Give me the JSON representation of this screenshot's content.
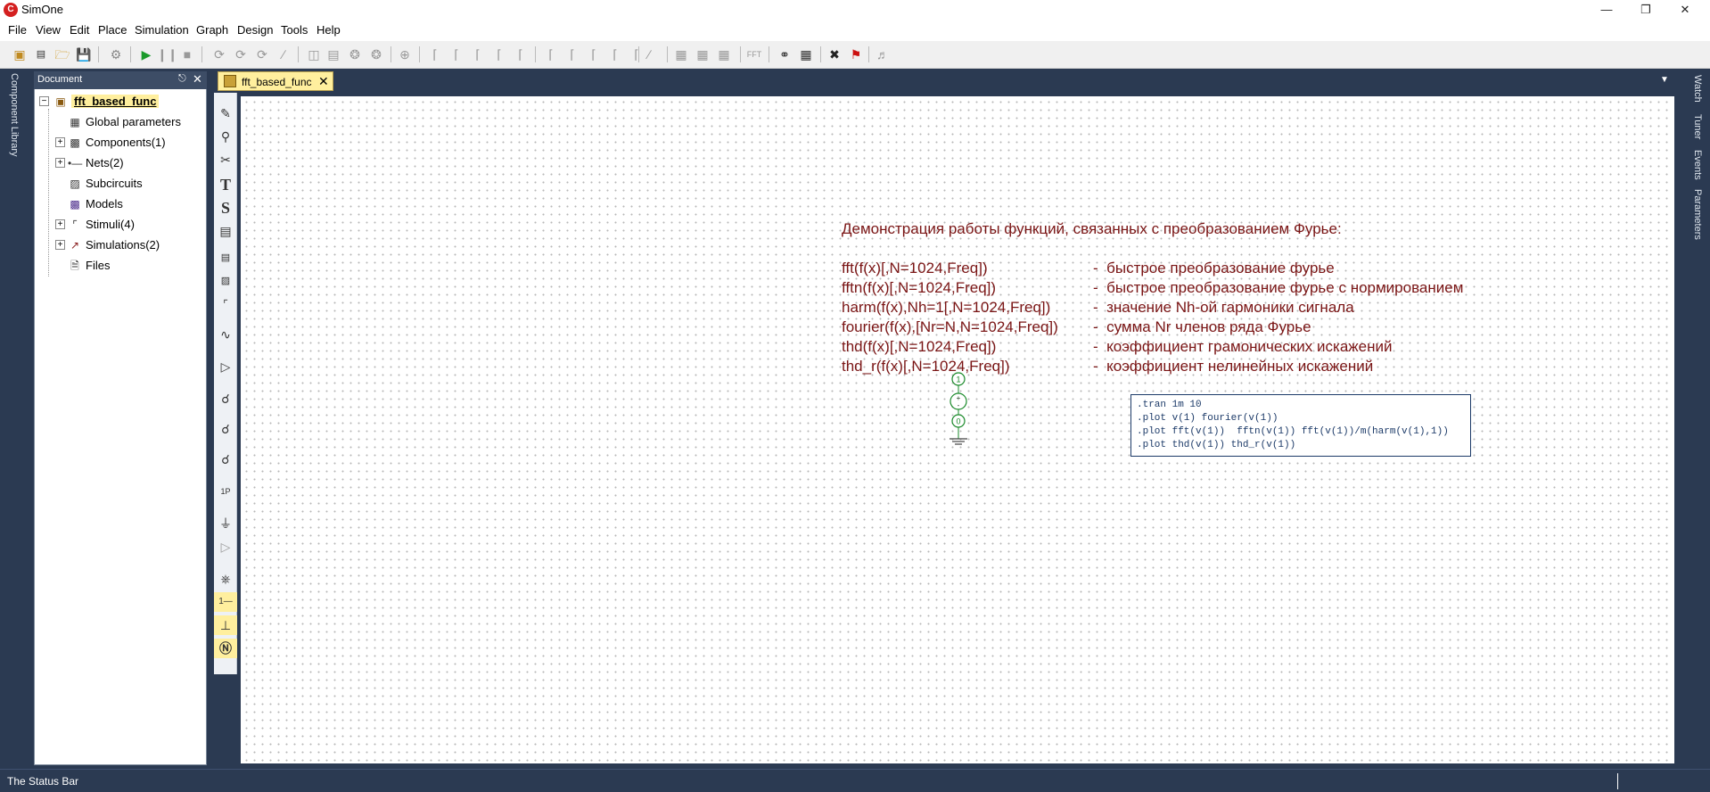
{
  "window": {
    "title": "SimOne",
    "logo": "simone-logo-icon"
  },
  "menubar": [
    "File",
    "View",
    "Edit",
    "Place",
    "Simulation",
    "Graph",
    "Design",
    "Tools",
    "Help"
  ],
  "left_strip": {
    "label": "Component Library"
  },
  "right_strip": {
    "labels": [
      "Watch",
      "Tuner",
      "Events",
      "Parameters"
    ]
  },
  "doc_panel": {
    "title": "Document",
    "root": "fft_based_func",
    "items": [
      {
        "label": "Global parameters",
        "icon": "parameters-icon",
        "expandable": false
      },
      {
        "label": "Components(1)",
        "icon": "components-icon",
        "expandable": true
      },
      {
        "label": "Nets(2)",
        "icon": "nets-icon",
        "expandable": true
      },
      {
        "label": "Subcircuits",
        "icon": "subcircuits-icon",
        "expandable": false
      },
      {
        "label": "Models",
        "icon": "models-icon",
        "expandable": false
      },
      {
        "label": "Stimuli(4)",
        "icon": "stimuli-icon",
        "expandable": true
      },
      {
        "label": "Simulations(2)",
        "icon": "simulations-icon",
        "expandable": true
      },
      {
        "label": "Files",
        "icon": "files-icon",
        "expandable": false
      }
    ]
  },
  "tabs": [
    {
      "label": "fft_based_func",
      "active": true
    }
  ],
  "canvas": {
    "heading": "Демонстрация работы функций, связанных с преобразованием Фурье:",
    "functions": [
      {
        "sig": "fft(f(x)[,N=1024,Freq])",
        "desc": "-  быстрое преобразование фурье"
      },
      {
        "sig": "fftn(f(x)[,N=1024,Freq])",
        "desc": "-  быстрое преобразование фурье с нормированием"
      },
      {
        "sig": "harm(f(x),Nh=1[,N=1024,Freq])",
        "desc": "-  значение Nh-ой гармоники сигнала"
      },
      {
        "sig": "fourier(f(x),[Nr=N,N=1024,Freq])",
        "desc": "-  сумма Nr членов ряда Фурье"
      },
      {
        "sig": "thd(f(x)[,N=1024,Freq])",
        "desc": "-  коэффициент грамонических искажений"
      },
      {
        "sig": "thd_r(f(x)[,N=1024,Freq])",
        "desc": "-  коэффициент нелинейных искажений"
      }
    ],
    "circuit": {
      "node_top": "1",
      "node_bottom": "0"
    },
    "directives": [
      ".tran 1m 10",
      ".plot v(1) fourier(v(1))",
      ".plot fft(v(1))  fftn(v(1)) fft(v(1))/m(harm(v(1),1))",
      ".plot thd(v(1)) thd_r(v(1))"
    ]
  },
  "statusbar": {
    "text": "The Status Bar"
  },
  "colors": {
    "frame": "#2b3a52",
    "annotation_text": "#7a1515",
    "directive_text": "#1c3a68",
    "highlight": "#ffef9e"
  }
}
